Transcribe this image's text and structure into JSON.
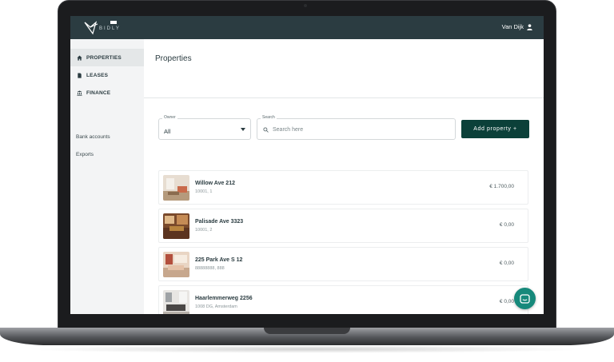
{
  "app": {
    "brand": "BIDLY",
    "user_name": "Van Dijk"
  },
  "sidebar": {
    "nav": [
      {
        "label": "PROPERTIES",
        "icon": "home-icon",
        "active": true
      },
      {
        "label": "LEASES",
        "icon": "document-icon",
        "active": false
      },
      {
        "label": "FINANCE",
        "icon": "bank-icon",
        "active": false
      }
    ],
    "links": [
      {
        "label": "Bank accounts"
      },
      {
        "label": "Exports"
      }
    ]
  },
  "main": {
    "title": "Properties",
    "owner_filter": {
      "label": "Owner",
      "value": "All"
    },
    "search": {
      "label": "Search",
      "placeholder": "Search here"
    },
    "add_button": "Add property +"
  },
  "properties": [
    {
      "name": "Willow Ave 212",
      "sub": "10001, 1",
      "amount": "€ 1.700,00",
      "thumb": "living-room-photo"
    },
    {
      "name": "Palisade Ave 3323",
      "sub": "10001, 2",
      "amount": "€ 0,00",
      "thumb": "kitchen-photo"
    },
    {
      "name": "225 Park Ave S 12",
      "sub": "88888888, 888",
      "amount": "€ 0,00",
      "thumb": "bedroom-photo"
    },
    {
      "name": "Haarlemmerweg 2256",
      "sub": "1008 DG, Amsterdam",
      "amount": "€ 0,00",
      "thumb": "office-photo"
    }
  ],
  "colors": {
    "topbar": "#2b3c41",
    "primary_button": "#0b4039",
    "chat_button": "#16897b",
    "sidebar_bg": "#f3f4f5"
  }
}
